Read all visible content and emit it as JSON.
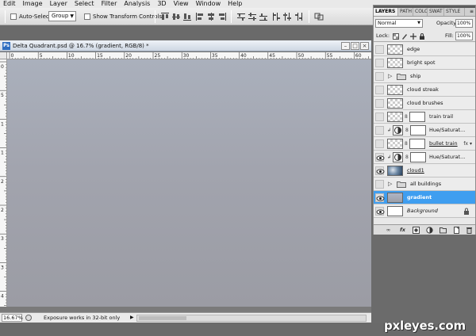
{
  "menu": [
    "Edit",
    "Image",
    "Layer",
    "Select",
    "Filter",
    "Analysis",
    "3D",
    "View",
    "Window",
    "Help"
  ],
  "options": {
    "auto_select_label": "Auto-Select:",
    "auto_select_value": "Group",
    "transform_label": "Show Transform Controls"
  },
  "document": {
    "title": "Delta Quadrant.psd @ 16.7% (gradient, RGB/8) *",
    "icon_label": "Ps",
    "ruler_h_labels": [
      "0",
      "5",
      "10",
      "15",
      "20",
      "25",
      "30",
      "35",
      "40",
      "45",
      "50",
      "55",
      "60"
    ],
    "ruler_v_labels": [
      "0",
      "5",
      "1",
      "1",
      "2",
      "2",
      "3",
      "3",
      "4"
    ]
  },
  "status": {
    "zoom": "16.67%",
    "message": "Exposure works in 32-bit only"
  },
  "layers_panel": {
    "tabs": [
      "LAYERS",
      "PATH",
      "COLO",
      "SWAT",
      "STYLE"
    ],
    "blend_mode": "Normal",
    "opacity_label": "Opacity:",
    "opacity_value": "100%",
    "lock_label": "Lock:",
    "fill_label": "Fill:",
    "fill_value": "100%",
    "layers": [
      {
        "name": "edge",
        "visible": false,
        "kind": "pixel"
      },
      {
        "name": "bright spot",
        "visible": false,
        "kind": "pixel"
      },
      {
        "name": "ship",
        "visible": false,
        "kind": "group"
      },
      {
        "name": "cloud streak",
        "visible": false,
        "kind": "pixel"
      },
      {
        "name": "cloud brushes",
        "visible": false,
        "kind": "pixel"
      },
      {
        "name": "train trail",
        "visible": false,
        "kind": "masked"
      },
      {
        "name": "Hue/Saturat...",
        "visible": false,
        "kind": "adjustment"
      },
      {
        "name": "bullet train",
        "visible": false,
        "kind": "smart"
      },
      {
        "name": "Hue/Saturat...",
        "visible": true,
        "kind": "adjustment"
      },
      {
        "name": "cloud1",
        "visible": true,
        "kind": "photo"
      },
      {
        "name": "all buildings",
        "visible": false,
        "kind": "group"
      },
      {
        "name": "gradient",
        "visible": true,
        "kind": "gradient",
        "selected": true
      },
      {
        "name": "Background",
        "visible": true,
        "kind": "background"
      }
    ],
    "footer_icons": [
      "link-layers-icon",
      "fx-icon",
      "mask-icon",
      "adjustment-icon",
      "folder-icon",
      "new-layer-icon",
      "trash-icon"
    ]
  },
  "watermark": "pxleyes.com",
  "colors": {
    "selection": "#3f9ef0",
    "canvas_top": "#aab0bc",
    "canvas_bottom": "#9b9ca4"
  }
}
